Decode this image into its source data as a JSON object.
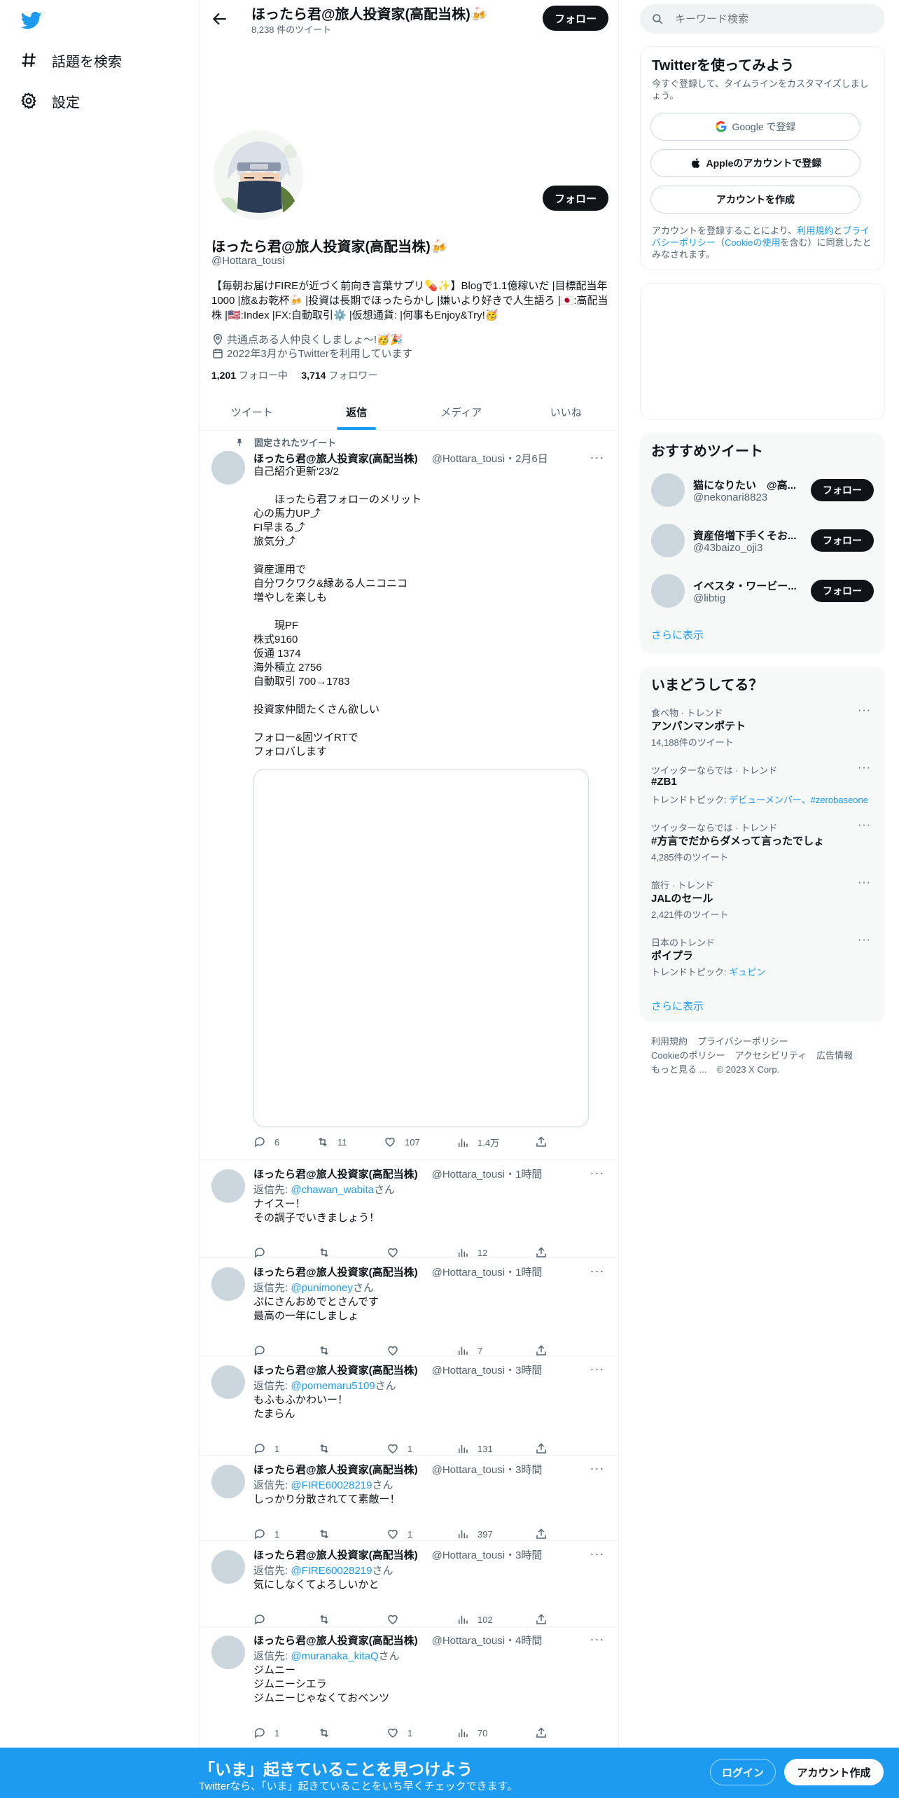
{
  "nav": {
    "explore_label": "話題を検索",
    "settings_label": "設定"
  },
  "profile": {
    "topbar_name": "ほったら君@旅人投資家(高配当株)🍻",
    "tweet_count": "8,238 件のツイート",
    "follow_label": "フォロー",
    "name": "ほったら君@旅人投資家(高配当株)🍻",
    "handle": "@Hottara_tousi",
    "bio": "【毎朝お届けFIREが近づく前向き言葉サプリ💊✨】Blogで1.1億稼いだ |目標配当年1000 |旅&お乾杯🍻 |投資は長期でほったらかし |嫌いより好きで人生語ろ |🇯🇵:高配当株 |🇺🇸:Index |FX:自動取引⚙️ |仮想通貨: |何事もEnjoy&Try!🥳",
    "location": "共通点ある人仲良くしましょ〜!🥳🎉",
    "joined": "2022年3月からTwitterを利用しています",
    "following_count": "1,201",
    "following_label": "フォロー中",
    "followers_count": "3,714",
    "followers_label": "フォロワー"
  },
  "tabs": [
    "ツイート",
    "返信",
    "メディア",
    "いいね"
  ],
  "pinned_label": "固定されたツイート",
  "tweets": [
    {
      "name": "ほったら君@旅人投資家(高配当株)",
      "handle_time": "@Hottara_tousi・2月6日",
      "reply_prefix": "",
      "reply_to": "",
      "reply_suffix": "",
      "body": "自己紹介更新'23/2\n\n　　ほったら君フォローのメリット\n心の馬力UP⤴︎\nFI早まる⤴︎\n旅気分⤴︎\n\n資産運用で\n自分ワクワク&縁ある人ニコニコ\n増やしを楽しも\n\n　　現PF\n株式9160\n仮通 1374\n海外積立 2756\n自動取引 700→1783\n\n投資家仲間たくさん欲しい\n\nフォロー&固ツイRTで\nフォロバします",
      "replies": "6",
      "retweets": "11",
      "likes": "107",
      "views": "1.4万"
    },
    {
      "name": "ほったら君@旅人投資家(高配当株)",
      "handle_time": "@Hottara_tousi・1時間",
      "reply_prefix": "返信先: ",
      "reply_to": "@chawan_wabita",
      "reply_suffix": "さん",
      "body": "ナイスー！\nその調子でいきましょう！",
      "replies": "",
      "retweets": "",
      "likes": "",
      "views": "12"
    },
    {
      "name": "ほったら君@旅人投資家(高配当株)",
      "handle_time": "@Hottara_tousi・1時間",
      "reply_prefix": "返信先: ",
      "reply_to": "@punimoney",
      "reply_suffix": "さん",
      "body": "ぷにさんおめでとさんです\n最高の一年にしましょ",
      "replies": "",
      "retweets": "",
      "likes": "",
      "views": "7"
    },
    {
      "name": "ほったら君@旅人投資家(高配当株)",
      "handle_time": "@Hottara_tousi・3時間",
      "reply_prefix": "返信先: ",
      "reply_to": "@pomemaru5109",
      "reply_suffix": "さん",
      "body": "もふもふかわいー！\nたまらん",
      "replies": "1",
      "retweets": "",
      "likes": "1",
      "views": "131"
    },
    {
      "name": "ほったら君@旅人投資家(高配当株)",
      "handle_time": "@Hottara_tousi・3時間",
      "reply_prefix": "返信先: ",
      "reply_to": "@FIRE60028219",
      "reply_suffix": "さん",
      "body": "しっかり分散されてて素敵ー！",
      "replies": "1",
      "retweets": "",
      "likes": "1",
      "views": "397"
    },
    {
      "name": "ほったら君@旅人投資家(高配当株)",
      "handle_time": "@Hottara_tousi・3時間",
      "reply_prefix": "返信先: ",
      "reply_to": "@FIRE60028219",
      "reply_suffix": "さん",
      "body": "気にしなくてよろしいかと",
      "replies": "",
      "retweets": "",
      "likes": "",
      "views": "102"
    },
    {
      "name": "ほったら君@旅人投資家(高配当株)",
      "handle_time": "@Hottara_tousi・4時間",
      "reply_prefix": "返信先: ",
      "reply_to": "@muranaka_kitaQ",
      "reply_suffix": "さん",
      "body": "ジムニー\nジムニーシエラ\nジムニーじゃなくておベンツ",
      "replies": "1",
      "retweets": "",
      "likes": "1",
      "views": "70"
    }
  ],
  "search": {
    "placeholder": "キーワード検索"
  },
  "signup": {
    "title": "Twitterを使ってみよう",
    "subtitle": "今すぐ登録して、タイムラインをカスタマイズしましょう。",
    "google": "Google で登録",
    "apple": "Appleのアカウントで登録",
    "create": "アカウントを作成",
    "terms_1": "アカウントを登録することにより、",
    "terms_link1": "利用規約",
    "terms_2": "と",
    "terms_link2": "プライバシーポリシー",
    "terms_3": "（",
    "terms_link3": "Cookieの使用",
    "terms_4": "を含む）に同意したとみなされます。"
  },
  "recommend": {
    "title": "おすすめツイート",
    "items": [
      {
        "name": "猫になりたい　@高...",
        "handle": "@nekonari8823"
      },
      {
        "name": "資産倍増下手くそお...",
        "handle": "@43baizo_oji3"
      },
      {
        "name": "イベスタ・ワービー...",
        "handle": "@libtig"
      }
    ],
    "follow_label": "フォロー",
    "show_more": "さらに表示"
  },
  "trends": {
    "title": "いまどうしてる？",
    "items": [
      {
        "category": "食べ物 · トレンド",
        "name": "アンパンマンポテト",
        "sub": "14,188件のツイート",
        "topic_label": "",
        "topic_links": ""
      },
      {
        "category": "ツイッターならでは · トレンド",
        "name": "#ZB1",
        "sub": "",
        "topic_label": "トレンドトピック: ",
        "topic_links": "デビューメンバー、#zerobaseone"
      },
      {
        "category": "ツイッターならでは · トレンド",
        "name": "#方言でだからダメって言ったでしょ",
        "sub": "4,285件のツイート",
        "topic_label": "",
        "topic_links": ""
      },
      {
        "category": "旅行 · トレンド",
        "name": "JALのセール",
        "sub": "2,421件のツイート",
        "topic_label": "",
        "topic_links": ""
      },
      {
        "category": "日本のトレンド",
        "name": "ポイプラ",
        "sub": "",
        "topic_label": "トレンドトピック: ",
        "topic_links": "ギュピン"
      }
    ],
    "show_more": "さらに表示"
  },
  "footer": {
    "terms": "利用規約",
    "privacy": "プライバシーポリシー",
    "cookie": "Cookieのポリシー",
    "accessibility": "アクセシビリティ",
    "ads": "広告情報",
    "more": "もっと見る ...",
    "copyright": "© 2023 X Corp."
  },
  "bottombar": {
    "title": "「いま」起きていることを見つけよう",
    "subtitle": "Twitterなら、「いま」起きていることをいち早くチェックできます。",
    "login": "ログイン",
    "signup": "アカウント作成"
  }
}
